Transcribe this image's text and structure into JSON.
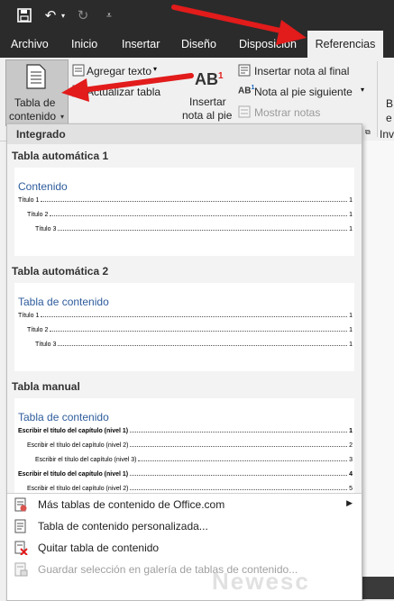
{
  "qat": {
    "undo_symbol": "↶",
    "redo_symbol": "↻"
  },
  "tabs": [
    {
      "label": "Archivo"
    },
    {
      "label": "Inicio"
    },
    {
      "label": "Insertar"
    },
    {
      "label": "Diseño"
    },
    {
      "label": "Disposición"
    },
    {
      "label": "Referencias"
    }
  ],
  "ribbon": {
    "toc_button_line1": "Tabla de",
    "toc_button_line2": "contenido",
    "add_text": "Agregar texto",
    "update_table": "Actualizar tabla",
    "insert_footnote_line1": "Insertar",
    "insert_footnote_line2": "nota al pie",
    "insert_endnote": "Insertar nota al final",
    "next_footnote": "Nota al pie siguiente",
    "show_notes": "Mostrar notas",
    "ab_icon_text": "AB",
    "ab_superscript": "1",
    "ab_small_text": "AB",
    "ab_small_superscript": "1",
    "right_cut_b": "B",
    "right_cut_e": "e",
    "right_cut_inv": "Inv"
  },
  "panel": {
    "header": "Integrado",
    "sections": [
      {
        "title": "Tabla automática 1",
        "heading": "Contenido",
        "entries": [
          {
            "text": "Título 1",
            "page": "1",
            "level": 1
          },
          {
            "text": "Título 2",
            "page": "1",
            "level": 2
          },
          {
            "text": "Título 3",
            "page": "1",
            "level": 3
          }
        ]
      },
      {
        "title": "Tabla automática 2",
        "heading": "Tabla de contenido",
        "entries": [
          {
            "text": "Título 1",
            "page": "1",
            "level": 1
          },
          {
            "text": "Título 2",
            "page": "1",
            "level": 2
          },
          {
            "text": "Título 3",
            "page": "1",
            "level": 3
          }
        ]
      },
      {
        "title": "Tabla manual",
        "heading": "Tabla de contenido",
        "entries": [
          {
            "text": "Escribir el título del capítulo (nivel 1)",
            "page": "1",
            "level": 1
          },
          {
            "text": "Escribir el título del capítulo (nivel 2)",
            "page": "2",
            "level": 2
          },
          {
            "text": "Escribir el título del capítulo (nivel 3)",
            "page": "3",
            "level": 3
          },
          {
            "text": "Escribir el título del capítulo (nivel 1)",
            "page": "4",
            "level": 1
          },
          {
            "text": "Escribir el título del capítulo (nivel 2)",
            "page": "5",
            "level": 2
          }
        ]
      }
    ],
    "menu": [
      {
        "label": "Más tablas de contenido de Office.com",
        "icon": "office-toc-icon",
        "submenu": true,
        "disabled": false
      },
      {
        "label": "Tabla de contenido personalizada...",
        "icon": "custom-toc-icon",
        "submenu": false,
        "disabled": false
      },
      {
        "label": "Quitar tabla de contenido",
        "icon": "remove-toc-icon",
        "submenu": false,
        "disabled": false
      },
      {
        "label": "Guardar selección en galería de tablas de contenido...",
        "icon": "save-selection-icon",
        "submenu": false,
        "disabled": true
      }
    ]
  },
  "watermark": "Newesc",
  "colors": {
    "accent_arrow": "#e21b1b",
    "toc_heading": "#2e5c9c",
    "titlebar": "#2b2b2b"
  }
}
